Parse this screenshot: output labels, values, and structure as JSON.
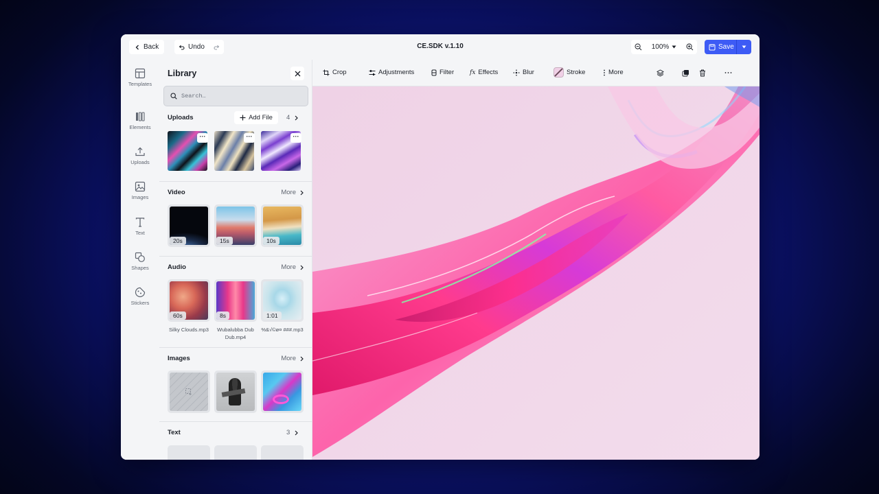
{
  "topbar": {
    "back_label": "Back",
    "undo_label": "Undo",
    "title": "CE.SDK v.1.10",
    "zoom": "100%",
    "save_label": "Save"
  },
  "rail": [
    {
      "label": "Templates",
      "icon": "templates-icon"
    },
    {
      "label": "Elements",
      "icon": "elements-icon"
    },
    {
      "label": "Uploads",
      "icon": "upload-icon"
    },
    {
      "label": "Images",
      "icon": "image-icon"
    },
    {
      "label": "Text",
      "icon": "text-icon"
    },
    {
      "label": "Shapes",
      "icon": "shapes-icon"
    },
    {
      "label": "Stickers",
      "icon": "sticker-icon"
    }
  ],
  "library": {
    "title": "Library",
    "search_placeholder": "Search…",
    "uploads": {
      "title": "Uploads",
      "add_label": "Add File",
      "count": "4"
    },
    "video": {
      "title": "Video",
      "more": "More",
      "durations": [
        "20s",
        "15s",
        "10s"
      ]
    },
    "audio": {
      "title": "Audio",
      "more": "More",
      "durations": [
        "60s",
        "8s",
        "1:01"
      ],
      "names": [
        "Silky Clouds.mp3",
        "Wubalubba Dub Dub.mp4",
        "%&√©ø¤ ###.mp3"
      ]
    },
    "images": {
      "title": "Images",
      "more": "More"
    },
    "text": {
      "title": "Text",
      "count": "3"
    }
  },
  "toolbar": {
    "crop": "Crop",
    "adjustments": "Adjustments",
    "filter": "Filter",
    "effects": "Effects",
    "blur": "Blur",
    "stroke": "Stroke",
    "more": "More"
  },
  "colors": {
    "accent": "#3d5bf5",
    "canvas": "#f4dceb"
  }
}
